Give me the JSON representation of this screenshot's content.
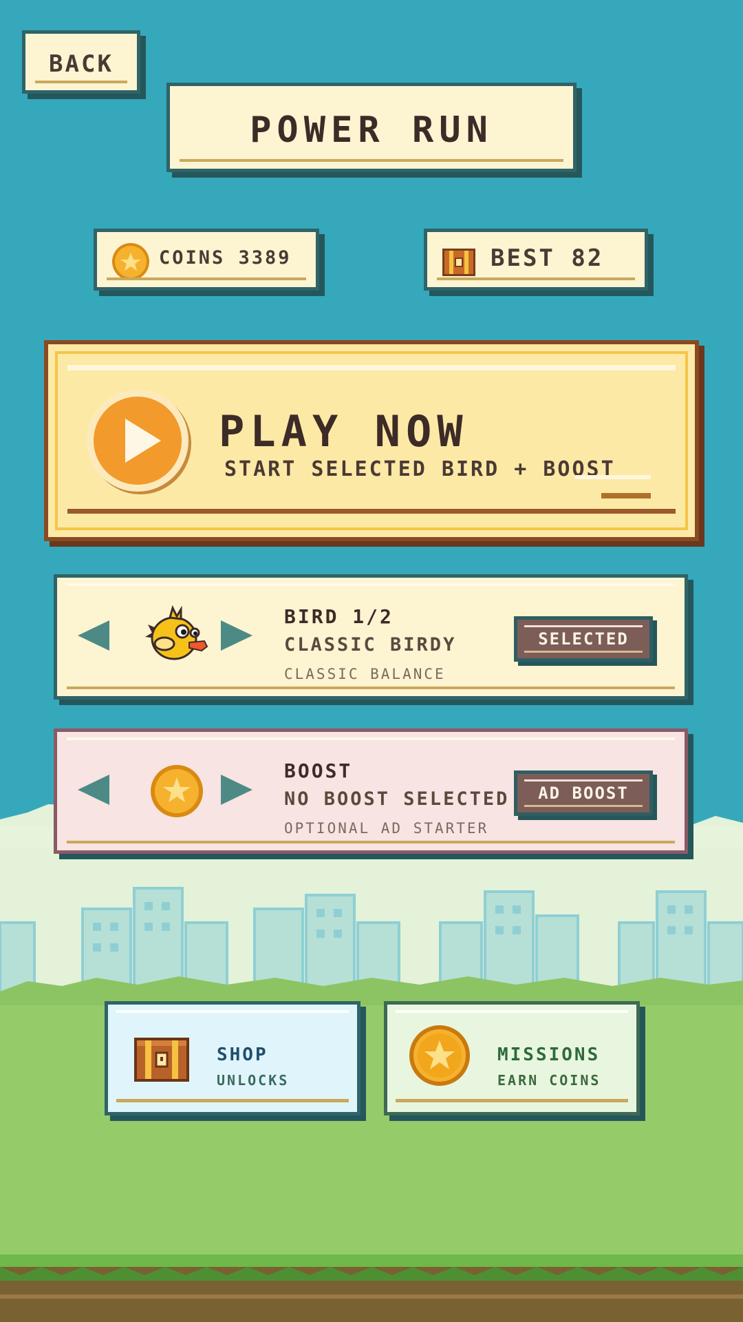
{
  "header": {
    "back_label": "BACK",
    "title": "POWER RUN"
  },
  "stats": {
    "coins_label": "COINS 3389",
    "best_label": "BEST 82"
  },
  "play": {
    "title": "PLAY NOW",
    "subtitle": "START SELECTED BIRD + BOOST"
  },
  "bird_selector": {
    "line1": "BIRD 1/2",
    "line2": "CLASSIC BIRDY",
    "line3": "CLASSIC BALANCE",
    "button": "SELECTED"
  },
  "boost_selector": {
    "line1": "BOOST",
    "line2": "NO BOOST SELECTED",
    "line3": "OPTIONAL AD STARTER",
    "button": "AD BOOST"
  },
  "shop": {
    "title": "SHOP",
    "subtitle": "UNLOCKS"
  },
  "missions": {
    "title": "MISSIONS",
    "subtitle": "EARN COINS"
  },
  "colors": {
    "sky": "#36a8bb",
    "grass": "#96cb6a",
    "panel": "#fdf4d2",
    "accent": "#f29a2c"
  },
  "icons": [
    "coin-icon",
    "chest-icon",
    "play-icon",
    "bird-icon",
    "arrow-left-icon",
    "arrow-right-icon"
  ]
}
